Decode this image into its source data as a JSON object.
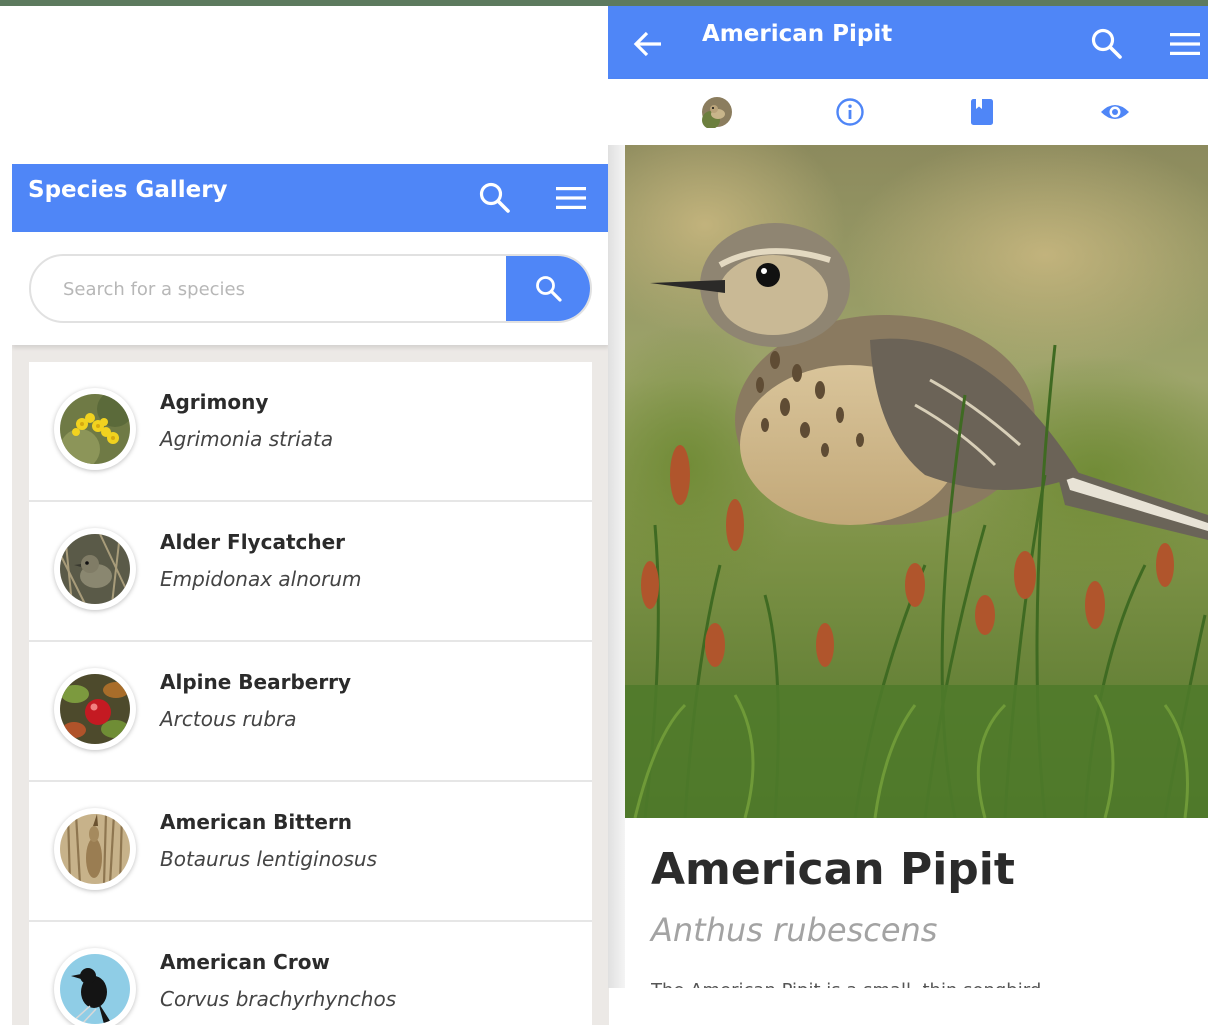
{
  "colors": {
    "accent": "#4f86f7",
    "top_strip": "#5d7a5e",
    "list_background": "#ece9e6"
  },
  "gallery": {
    "title": "Species Gallery",
    "search_placeholder": "Search for a species",
    "icons": {
      "search": "search-icon",
      "menu": "menu-icon"
    },
    "items": [
      {
        "common": "Agrimony",
        "scientific": "Agrimonia striata",
        "thumb": "yellow-flower"
      },
      {
        "common": "Alder Flycatcher",
        "scientific": "Empidonax alnorum",
        "thumb": "small-bird"
      },
      {
        "common": "Alpine Bearberry",
        "scientific": "Arctous rubra",
        "thumb": "red-berry"
      },
      {
        "common": "American Bittern",
        "scientific": "Botaurus lentiginosus",
        "thumb": "bittern-reeds"
      },
      {
        "common": "American Crow",
        "scientific": "Corvus brachyrhynchos",
        "thumb": "black-crow"
      }
    ]
  },
  "detail": {
    "title": "American Pipit",
    "common": "American Pipit",
    "scientific": "Anthus rubescens",
    "description": "The American Pipit is a small, thin songbird",
    "tabs": [
      "photo-tab",
      "info-tab",
      "book-tab",
      "view-tab"
    ],
    "icons": {
      "back": "arrow-back-icon",
      "search": "search-icon",
      "menu": "menu-icon"
    },
    "hero": "american-pipit-photo"
  }
}
